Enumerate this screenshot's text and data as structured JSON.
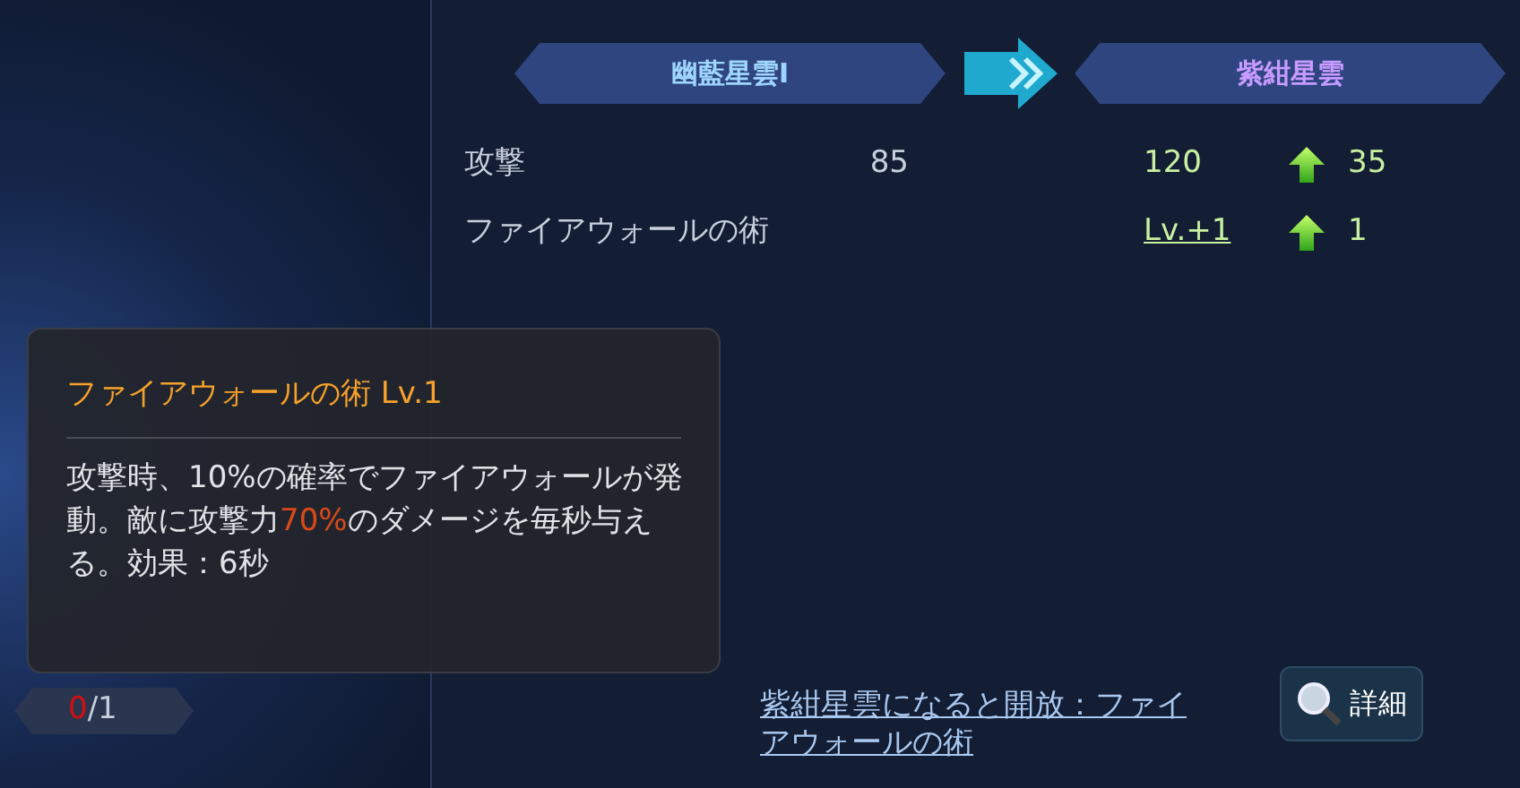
{
  "headers": {
    "from": "幽藍星雲I",
    "to": "紫紺星雲"
  },
  "stats": [
    {
      "kind": "value",
      "name": "攻撃",
      "current": "85",
      "next": "120",
      "increase": "35"
    },
    {
      "kind": "link",
      "name": "ファイアウォールの術",
      "next": "Lv.+1",
      "increase": "1"
    }
  ],
  "unlock_note": "紫紺星雲になると開放：ファイアウォールの術",
  "detail_button": "詳細",
  "counter": {
    "count": "0",
    "rest": "/1"
  },
  "tooltip": {
    "title": "ファイアウォールの術 Lv.1",
    "description": [
      {
        "text": "攻撃時、10%の確率でファイアウォールが発動。敵に攻撃力",
        "highlight": false
      },
      {
        "text": "70%",
        "highlight": true
      },
      {
        "text": "のダメージを毎秒与える。効果：6秒",
        "highlight": false
      }
    ]
  }
}
